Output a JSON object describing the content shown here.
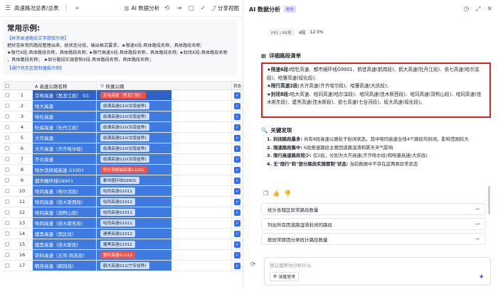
{
  "topbar": {
    "doc_title": "高速路况总表/总表",
    "ai_label": "AI 数据分析",
    "share_label": "分享视图"
  },
  "examples": {
    "heading": "常用示例:",
    "section1": "【异常高速路段文字提取示例】",
    "line1": "把状态异常的路段整理出来。按状态分段，输出格式要求，★限速X段:具体路段名称，具体路段名称;",
    "line2": "★限行X段:具体路段名称，具体路段名称;  ★限行高速X段:具体路段名称，具体路段名称;  ★封闭X段:具体路段名称",
    "line3": "，具体路段名称；  ★部分路段实施管制X段:具体路段名称，具体路段名称；",
    "section2": "【通行状态互管制播报示例】"
  },
  "table": {
    "headers": {
      "name": "A  高速公路名称",
      "road": "所属公路",
      "status": "状态"
    },
    "rows": [
      {
        "n": "1",
        "name": "京哈高速（黑龙江段）  G1",
        "road": "京哈高速（黑龙江段）",
        "red": true
      },
      {
        "n": "2",
        "name": "哈大高速",
        "road": "绥满高速G10(甘南省界)",
        "red": false
      },
      {
        "n": "3",
        "name": "哈牡高速",
        "road": "绥满高速G10(甘南省界)",
        "red": false
      },
      {
        "n": "4",
        "name": "牡绥高速（牡丹江段）",
        "road": "绥满高速G10(甘南省界)",
        "red": false
      },
      {
        "n": "5",
        "name": "大齐高速",
        "road": "绥满高速G10(甘南省界)",
        "red": false
      },
      {
        "n": "6",
        "name": "大齐高速（齐齐哈尔段）",
        "road": "绥满高速G10(甘南省界)",
        "red": false
      },
      {
        "n": "7",
        "name": "齐甘高速",
        "road": "绥满高速G10(甘南省界)",
        "red": false
      },
      {
        "n": "8",
        "name": "哈尔滨绕城高速 G1001",
        "road": "哈尔滨绕城高速G1001",
        "red": true
      },
      {
        "n": "9",
        "name": "都市圈环线G9901",
        "road": "都市圈环线G9901",
        "red": false
      },
      {
        "n": "10",
        "name": "哈同高速（哈尔滨段）",
        "road": "哈同高速G1011",
        "red": false
      },
      {
        "n": "11",
        "name": "哈同高速（佳木斯西段）",
        "road": "哈同高速G1011",
        "red": false
      },
      {
        "n": "12",
        "name": "哈同高速（双鸭山段）",
        "road": "哈同高速G1011",
        "red": false
      },
      {
        "n": "13",
        "name": "哈同高速（佳木斯东段）",
        "road": "哈同高速G1011",
        "red": false
      },
      {
        "n": "14",
        "name": "建黑高速（黑区段）",
        "road": "建黑高速G1012",
        "red": false
      },
      {
        "n": "15",
        "name": "建黑高速（佳木斯段）",
        "road": "建黑高速G1012",
        "red": false
      },
      {
        "n": "16",
        "name": "铁科高速（五常-尚志段）",
        "road": "铁科高速G1015",
        "red": true
      },
      {
        "n": "17",
        "name": "鹤佳高速（鹤岗段）",
        "road": "鹤大高速G11(宁安省界)",
        "red": false
      }
    ]
  },
  "panel": {
    "title": "AI 数据分析",
    "badge": "抢先",
    "mini_cols": [
      "PK1 | RK段",
      "4段",
      "12.5%"
    ],
    "detail_heading": "详细路段清单",
    "limit_label": "★限速6段:",
    "limit_text": "哈牡高速、都市圈环线G9901、鹤佳高速(鹤岗段)、鹤大高速(牡丹江段)、依七高速(哈尔滨段)、哈肇高速(绥化段);",
    "restrict_label": "★限行高速2段:",
    "restrict_text": "大齐高速(齐齐哈尔段)、哈肇高速(大庆段);",
    "closed_label": "★封闭8段:",
    "closed_text": "哈大高速、哈同高速(哈尔滨段)、哈同高速(佳木斯西段)、哈同高速(双鸭山段)、哈同高速(佳木斯东段)、建黑高速(佳木斯段)、依七高速(七台河段)、绥大高速(绥化段)。",
    "findings_heading": "关键发现",
    "f1_b": "1. 封闭路段最多:",
    "f1": " 共有8段高速公路处于封闭状态，其中哈同高速全线4个路段均封闭，影响范围较大",
    "f2_b": "2. 限速路段集中:",
    "f2": " 6段限速路段主要因道路湿滑和雾天天气影响",
    "f3_b": "3. 限行高速路段较少:",
    "f3": " 仅2段，分别为大齐高速(齐齐哈尔段)和哈肇高速(大庆段)",
    "f4_b": "4. 无\"限行\"和\"部分路段实施管制\"状态:",
    "f4": " 当前数据中不存在这两类异常状态",
    "suggestions": [
      "统计各辖区异常路段数量",
      "列出所有因道路湿滑封闭的路段",
      "按异常原因分类统计路段数量"
    ],
    "input_placeholder": "想让我帮你分析什么",
    "deep_label": "深度思考"
  }
}
